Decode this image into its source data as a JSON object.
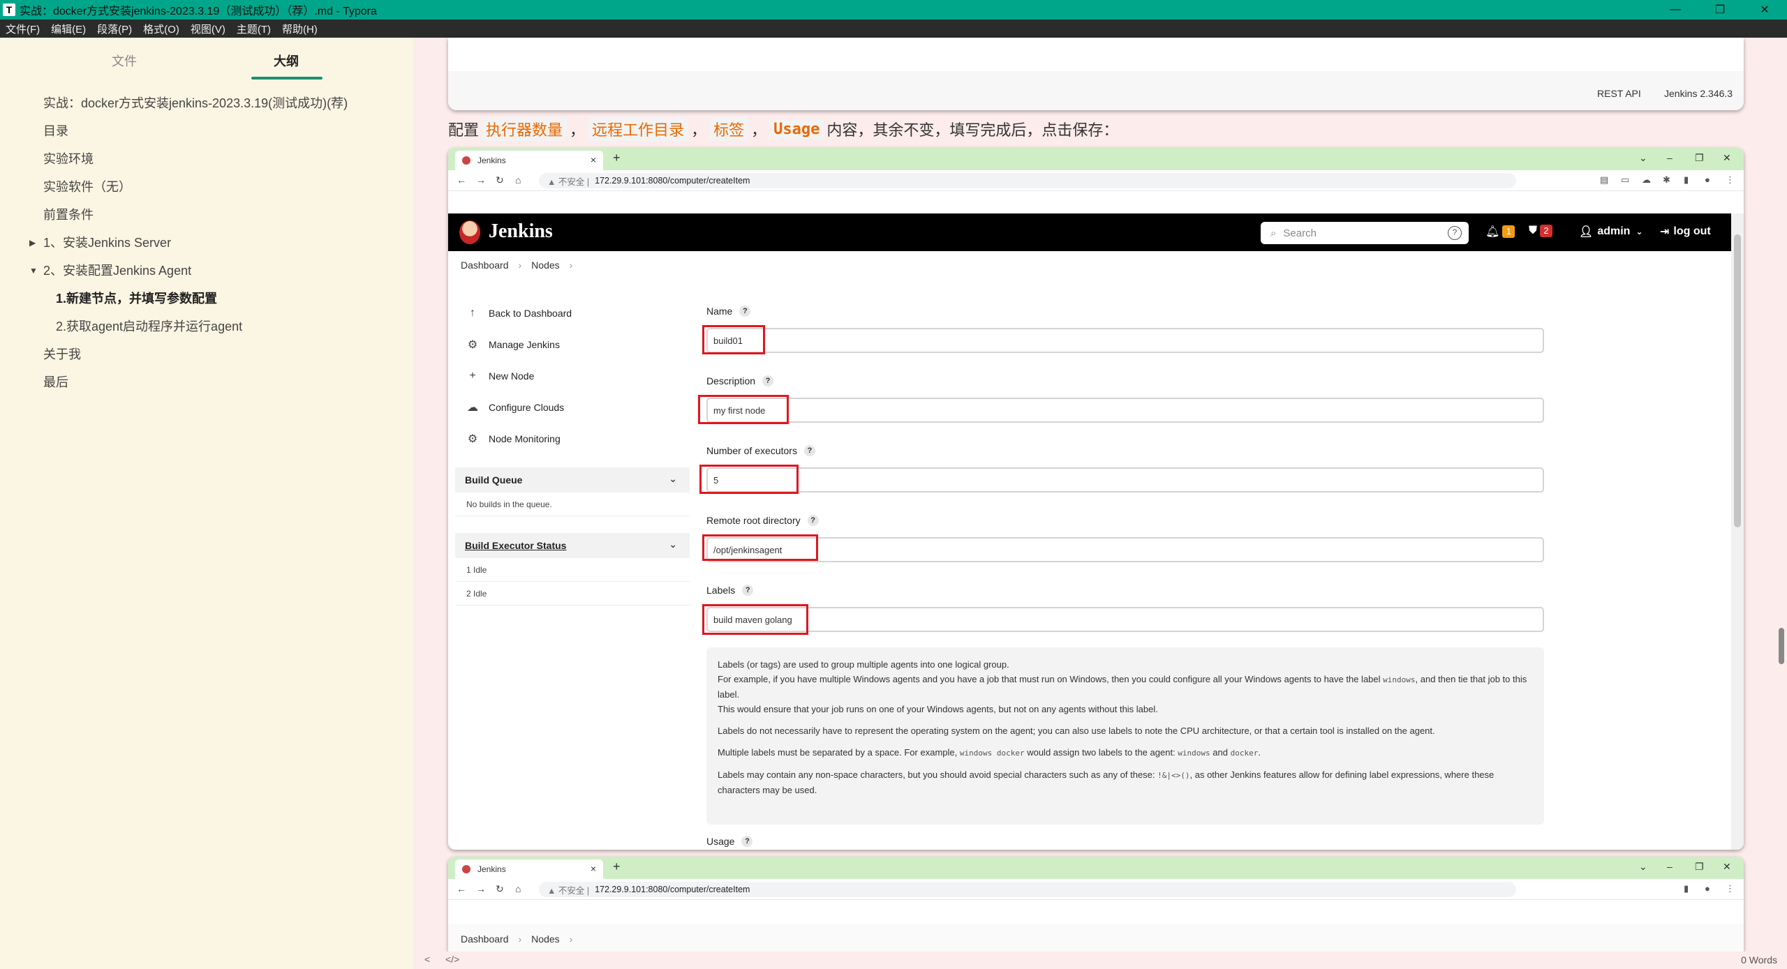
{
  "window": {
    "title": "实战：docker方式安装jenkins-2023.3.19（测试成功）（荐）.md - Typora",
    "app_icon_letter": "T",
    "controls": [
      "—",
      "❐",
      "✕"
    ]
  },
  "menubar": [
    "文件(F)",
    "编辑(E)",
    "段落(P)",
    "格式(O)",
    "视图(V)",
    "主题(T)",
    "帮助(H)"
  ],
  "sidebar": {
    "tab_files": "文件",
    "tab_outline": "大纲",
    "outline": [
      {
        "label": "实战：docker方式安装jenkins-2023.3.19(测试成功)(荐)",
        "level": 1
      },
      {
        "label": "目录",
        "level": 1
      },
      {
        "label": "实验环境",
        "level": 1
      },
      {
        "label": "实验软件（无）",
        "level": 1
      },
      {
        "label": "前置条件",
        "level": 1
      },
      {
        "label": "1、安装Jenkins Server",
        "level": 1,
        "arrow": "▶"
      },
      {
        "label": "2、安装配置Jenkins Agent",
        "level": 1,
        "arrow": "▼"
      },
      {
        "label": "1.新建节点，并填写参数配置",
        "level": 2,
        "active": true
      },
      {
        "label": "2.获取agent启动程序并运行agent",
        "level": 2
      },
      {
        "label": "关于我",
        "level": 1
      },
      {
        "label": "最后",
        "level": 1
      }
    ]
  },
  "prev_shot": {
    "rest_api": "REST API",
    "version": "Jenkins 2.346.3"
  },
  "paragraph": {
    "prefix": "配置",
    "code1": "执行器数量",
    "code2": "远程工作目录",
    "code3": "标签",
    "code4": "Usage",
    "suffix": "内容，其余不变，填写完成后，点击保存："
  },
  "browser": {
    "tab_title": "Jenkins",
    "url_warning": "▲ 不安全 |",
    "url": "172.29.9.101:8080/computer/createItem"
  },
  "jenkins": {
    "brand": "Jenkins",
    "search_placeholder": "Search",
    "notifications_count": "1",
    "security_count": "2",
    "user": "admin",
    "logout": "log out",
    "breadcrumb": [
      "Dashboard",
      "Nodes"
    ],
    "side_items": [
      {
        "icon": "↑",
        "label": "Back to Dashboard"
      },
      {
        "icon": "⚙",
        "label": "Manage Jenkins"
      },
      {
        "icon": "+",
        "label": "New Node"
      },
      {
        "icon": "☁",
        "label": "Configure Clouds"
      },
      {
        "icon": "⚙",
        "label": "Node Monitoring"
      }
    ],
    "build_queue": {
      "title": "Build Queue",
      "empty": "No builds in the queue."
    },
    "executor_status": {
      "title": "Build Executor Status",
      "rows": [
        "1  Idle",
        "2  Idle"
      ]
    },
    "form": {
      "name_label": "Name",
      "name_value": "build01",
      "description_label": "Description",
      "description_value": "my first node",
      "executors_label": "Number of executors",
      "executors_value": "5",
      "remote_root_label": "Remote root directory",
      "remote_root_value": "/opt/jenkinsagent",
      "labels_label": "Labels",
      "labels_value": "build maven golang",
      "usage_label": "Usage"
    },
    "labels_help": {
      "p1a": "Labels (or tags) are used to group multiple agents into one logical group.",
      "p1b": "For example, if you have multiple Windows agents and you have a job that must run on Windows, then you could configure all your Windows agents to have the label",
      "p1b_code": "windows",
      "p1c": ", and then tie that job to this label.",
      "p1d": "This would ensure that your job runs on one of your Windows agents, but not on any agents without this label.",
      "p2": "Labels do not necessarily have to represent the operating system on the agent; you can also use labels to note the CPU architecture, or that a certain tool is installed on the agent.",
      "p3a": "Multiple labels must be separated by a space. For example,",
      "p3_code1": "windows docker",
      "p3b": "would assign two labels to the agent:",
      "p3_code2": "windows",
      "p3c": "and",
      "p3_code3": "docker",
      "p3d": ".",
      "p4a": "Labels may contain any non-space characters, but you should avoid special characters such as any of these:",
      "p4_code": "!&|<>()",
      "p4b": ", as other Jenkins features allow for defining label expressions, where these characters may be used."
    }
  },
  "statusbar": {
    "left": "<",
    "source": "</>",
    "words": "0 Words"
  }
}
